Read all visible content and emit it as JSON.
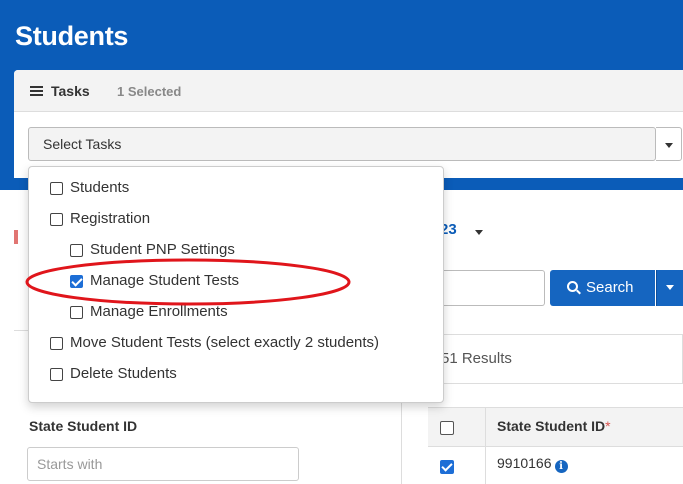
{
  "page": {
    "title": "Students"
  },
  "tasks": {
    "label": "Tasks",
    "count_label": "1 Selected",
    "select_value": "Select Tasks",
    "options": [
      {
        "label": "Students",
        "checked": false,
        "indent": 0
      },
      {
        "label": "Registration",
        "checked": false,
        "indent": 0
      },
      {
        "label": "Student PNP Settings",
        "checked": false,
        "indent": 1
      },
      {
        "label": "Manage Student Tests",
        "checked": true,
        "indent": 1
      },
      {
        "label": "Manage Enrollments",
        "checked": false,
        "indent": 1
      },
      {
        "label": "Move Student Tests (select exactly 2 students)",
        "checked": false,
        "indent": 0
      },
      {
        "label": "Delete Students",
        "checked": false,
        "indent": 0
      }
    ]
  },
  "toolbar": {
    "year_partial": "23",
    "search_label": "Search"
  },
  "results": {
    "text": "51 Results"
  },
  "filters": {
    "state_student_id_label": "State Student ID",
    "state_student_id_placeholder": "Starts with"
  },
  "table": {
    "column_header": "State Student ID",
    "required_mark": "*",
    "rows": [
      {
        "id": "9910166",
        "checked": true
      }
    ]
  },
  "colors": {
    "header_blue": "#0b5cb8",
    "button_blue": "#1565c0",
    "checkbox_blue": "#1d6ed6",
    "annotation_red": "#e0151b"
  },
  "annotation": {
    "shape": "ellipse",
    "target": "Manage Student Tests"
  }
}
